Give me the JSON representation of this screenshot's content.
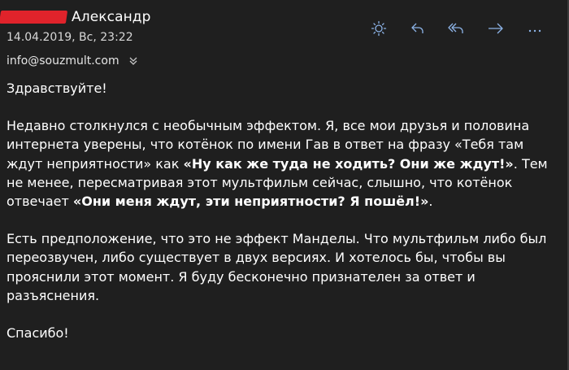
{
  "header": {
    "sender_name": "Александр",
    "date": "14.04.2019, Вс, 23:22",
    "from_address": "info@souzmult.com"
  },
  "toolbar": {
    "icons": [
      "brightness-icon",
      "reply-icon",
      "reply-all-icon",
      "forward-icon",
      "more-icon"
    ],
    "accent_color": "#8db4e8"
  },
  "message": {
    "greeting": "Здравствуйте!",
    "p1_a": "Недавно столкнулся с необычным эффектом. Я, все мои друзья и половина интернета уверены, что котёнок по имени Гав в ответ на фразу «Тебя там ждут неприятности» как ",
    "p1_b": "«Ну как же туда не ходить? Они же ждут!»",
    "p1_c": ". Тем не менее, пересматривая этот мультфильм сейчас, слышно, что котёнок отвечает ",
    "p1_d": "«Они меня ждут, эти неприятности? Я пошёл!»",
    "p1_e": ".",
    "p2": "Есть предположение, что это не эффект Манделы. Что мультфильм либо был переозвучен, либо существует в двух версиях. И хотелось бы, чтобы вы прояснили этот момент. Я буду бесконечно признателен за ответ и разъяснения.",
    "closing": "Спасибо!"
  },
  "colors": {
    "background": "#1f1f1f",
    "text": "#ffffff",
    "redaction": "#e0232b"
  }
}
